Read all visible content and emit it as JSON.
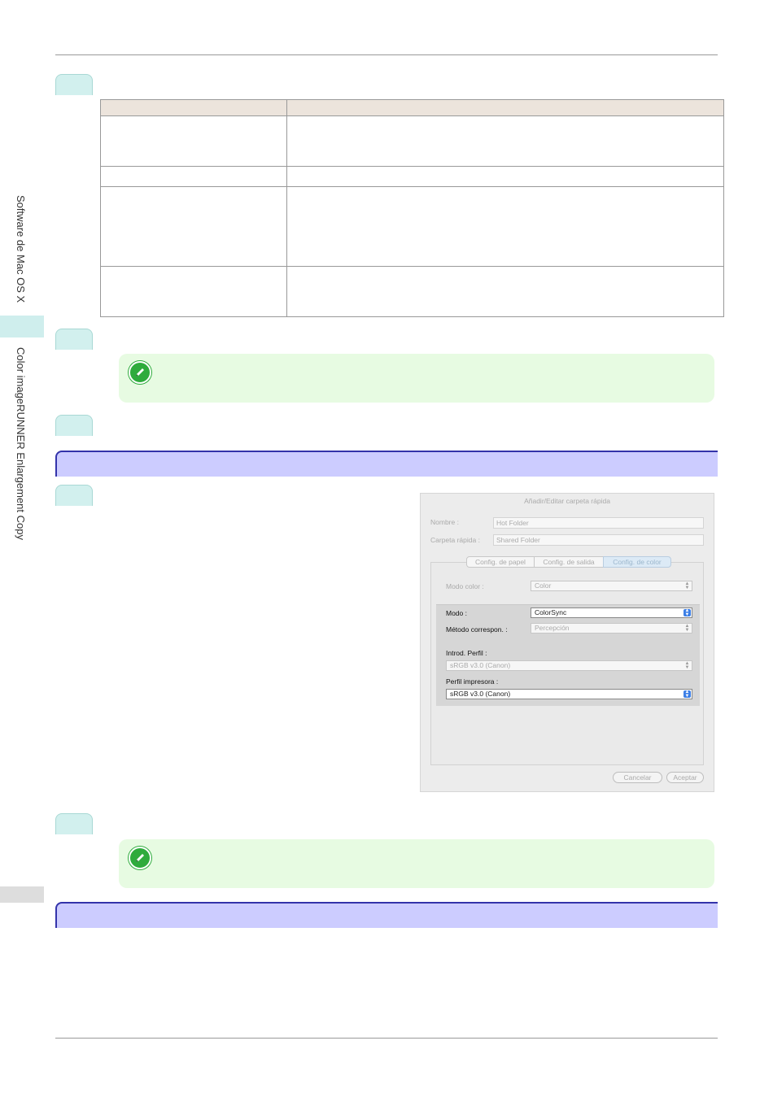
{
  "sidebar": {
    "section_label": "Software de Mac OS X",
    "chapter_label": "Color imageRUNNER Enlargement Copy"
  },
  "dialog": {
    "title": "Añadir/Editar carpeta rápida",
    "name_label": "Nombre :",
    "name_value": "Hot Folder",
    "folder_label": "Carpeta rápida :",
    "folder_value": "Shared Folder",
    "tabs": [
      {
        "label": "Config. de papel"
      },
      {
        "label": "Config. de salida"
      },
      {
        "label": "Config. de color"
      }
    ],
    "color_mode_label": "Modo color :",
    "color_mode_value": "Color",
    "mode_label": "Modo :",
    "mode_value": "ColorSync",
    "matching_label": "Método correspon. :",
    "matching_value": "Percepción",
    "input_profile_label": "Introd. Perfil :",
    "input_profile_value": "sRGB v3.0 (Canon)",
    "printer_profile_label": "Perfil impresora :",
    "printer_profile_value": "sRGB v3.0 (Canon)",
    "cancel_label": "Cancelar",
    "accept_label": "Aceptar"
  },
  "colors": {
    "step_tab": "#d2f0ee",
    "note_bg": "#e7fbe2",
    "section_bar": "#ccccff",
    "section_border": "#3333aa"
  }
}
